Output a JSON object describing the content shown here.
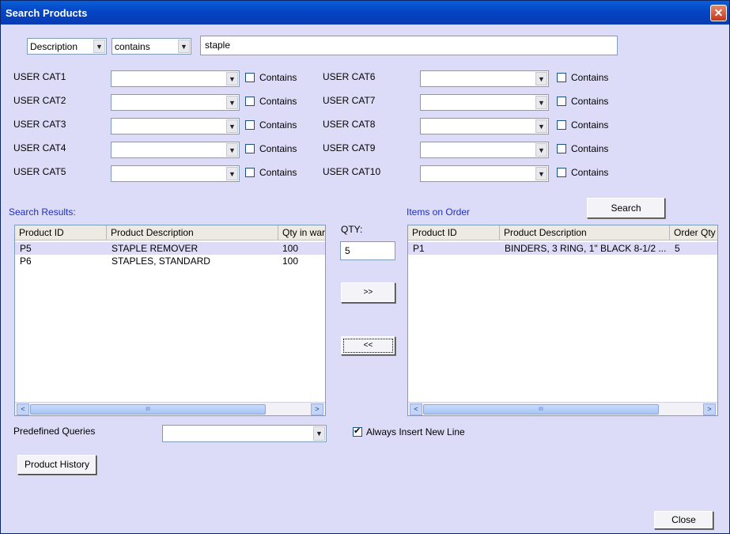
{
  "window": {
    "title": "Search Products",
    "close_glyph": "✕"
  },
  "search": {
    "field": "Description",
    "operator": "contains",
    "value": "staple"
  },
  "user_cats": [
    {
      "label": "USER CAT1",
      "contains": "Contains"
    },
    {
      "label": "USER CAT2",
      "contains": "Contains"
    },
    {
      "label": "USER CAT3",
      "contains": "Contains"
    },
    {
      "label": "USER CAT4",
      "contains": "Contains"
    },
    {
      "label": "USER CAT5",
      "contains": "Contains"
    },
    {
      "label": "USER CAT6",
      "contains": "Contains"
    },
    {
      "label": "USER CAT7",
      "contains": "Contains"
    },
    {
      "label": "USER CAT8",
      "contains": "Contains"
    },
    {
      "label": "USER CAT9",
      "contains": "Contains"
    },
    {
      "label": "USER CAT10",
      "contains": "Contains"
    }
  ],
  "search_button": "Search",
  "results": {
    "label": "Search Results:",
    "columns": [
      "Product ID",
      "Product Description",
      "Qty in wareh"
    ],
    "rows": [
      [
        "P5",
        "STAPLE REMOVER",
        "100"
      ],
      [
        "P6",
        "STAPLES, STANDARD",
        "100"
      ]
    ]
  },
  "qty": {
    "label": "QTY:",
    "value": "5"
  },
  "move_right": ">>",
  "move_left": "<<",
  "order": {
    "label": "Items on Order",
    "columns": [
      "Product ID",
      "Product Description",
      "Order Qty"
    ],
    "rows": [
      [
        "P1",
        "BINDERS, 3 RING, 1\" BLACK 8-1/2 ...",
        "5"
      ]
    ]
  },
  "predefined": {
    "label": "Predefined Queries",
    "value": ""
  },
  "always_insert": {
    "label": "Always Insert New Line",
    "checked": true
  },
  "product_history": "Product History",
  "close_button": "Close",
  "scrollbar": {
    "left": "<",
    "right": ">",
    "grip": "III"
  },
  "dropdown_arrow": "▼"
}
